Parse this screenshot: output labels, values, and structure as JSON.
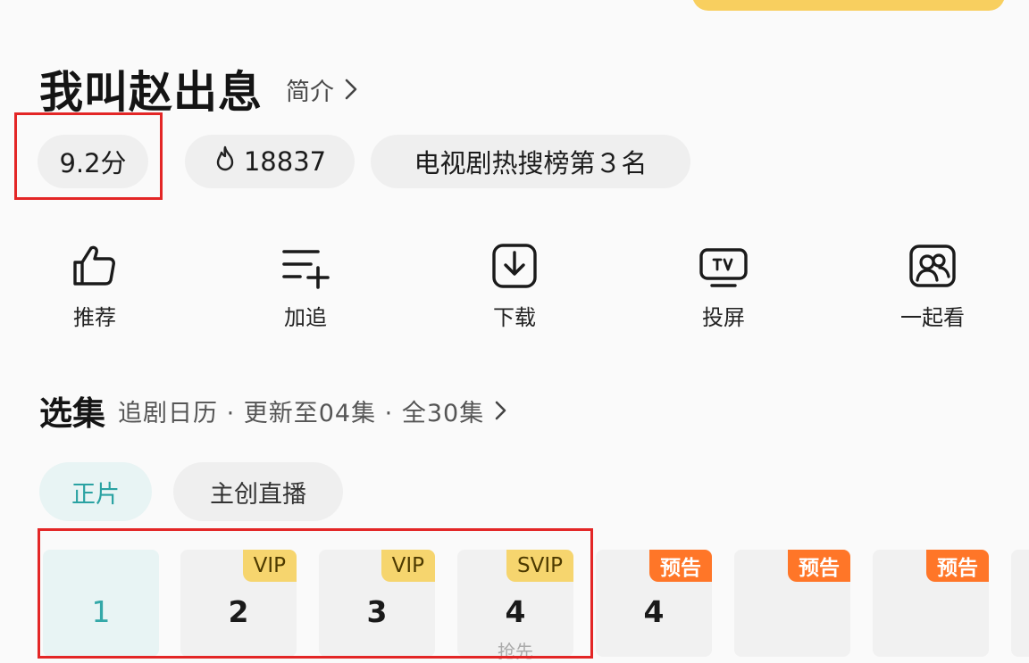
{
  "show": {
    "title": "我叫赵出息",
    "intro_label": "简介"
  },
  "stats": {
    "score": "9.2分",
    "heat": "18837",
    "rank": "电视剧热搜榜第３名"
  },
  "actions": [
    {
      "label": "推荐",
      "icon": "thumbs-up-icon"
    },
    {
      "label": "加追",
      "icon": "add-to-list-icon"
    },
    {
      "label": "下载",
      "icon": "download-icon"
    },
    {
      "label": "投屏",
      "icon": "tv-cast-icon"
    },
    {
      "label": "一起看",
      "icon": "watch-together-icon"
    }
  ],
  "episodes_section": {
    "title": "选集",
    "meta": "追剧日历 · 更新至04集 · 全30集"
  },
  "tabs": [
    {
      "label": "正片",
      "selected": true
    },
    {
      "label": "主创直播",
      "selected": false
    }
  ],
  "episodes": [
    {
      "number": "1",
      "badge": "",
      "active": true
    },
    {
      "number": "2",
      "badge": "VIP"
    },
    {
      "number": "3",
      "badge": "VIP"
    },
    {
      "number": "4",
      "badge": "SVIP",
      "sub": "抢先"
    },
    {
      "number": "4",
      "badge": "预告"
    },
    {
      "number": "",
      "badge": "预告"
    },
    {
      "number": "",
      "badge": "预告"
    }
  ],
  "colors": {
    "accent_teal": "#2aa2a2",
    "highlight_red": "#e32626",
    "vip_gold": "#f6d56e",
    "preview_orange": "#ff7628"
  }
}
